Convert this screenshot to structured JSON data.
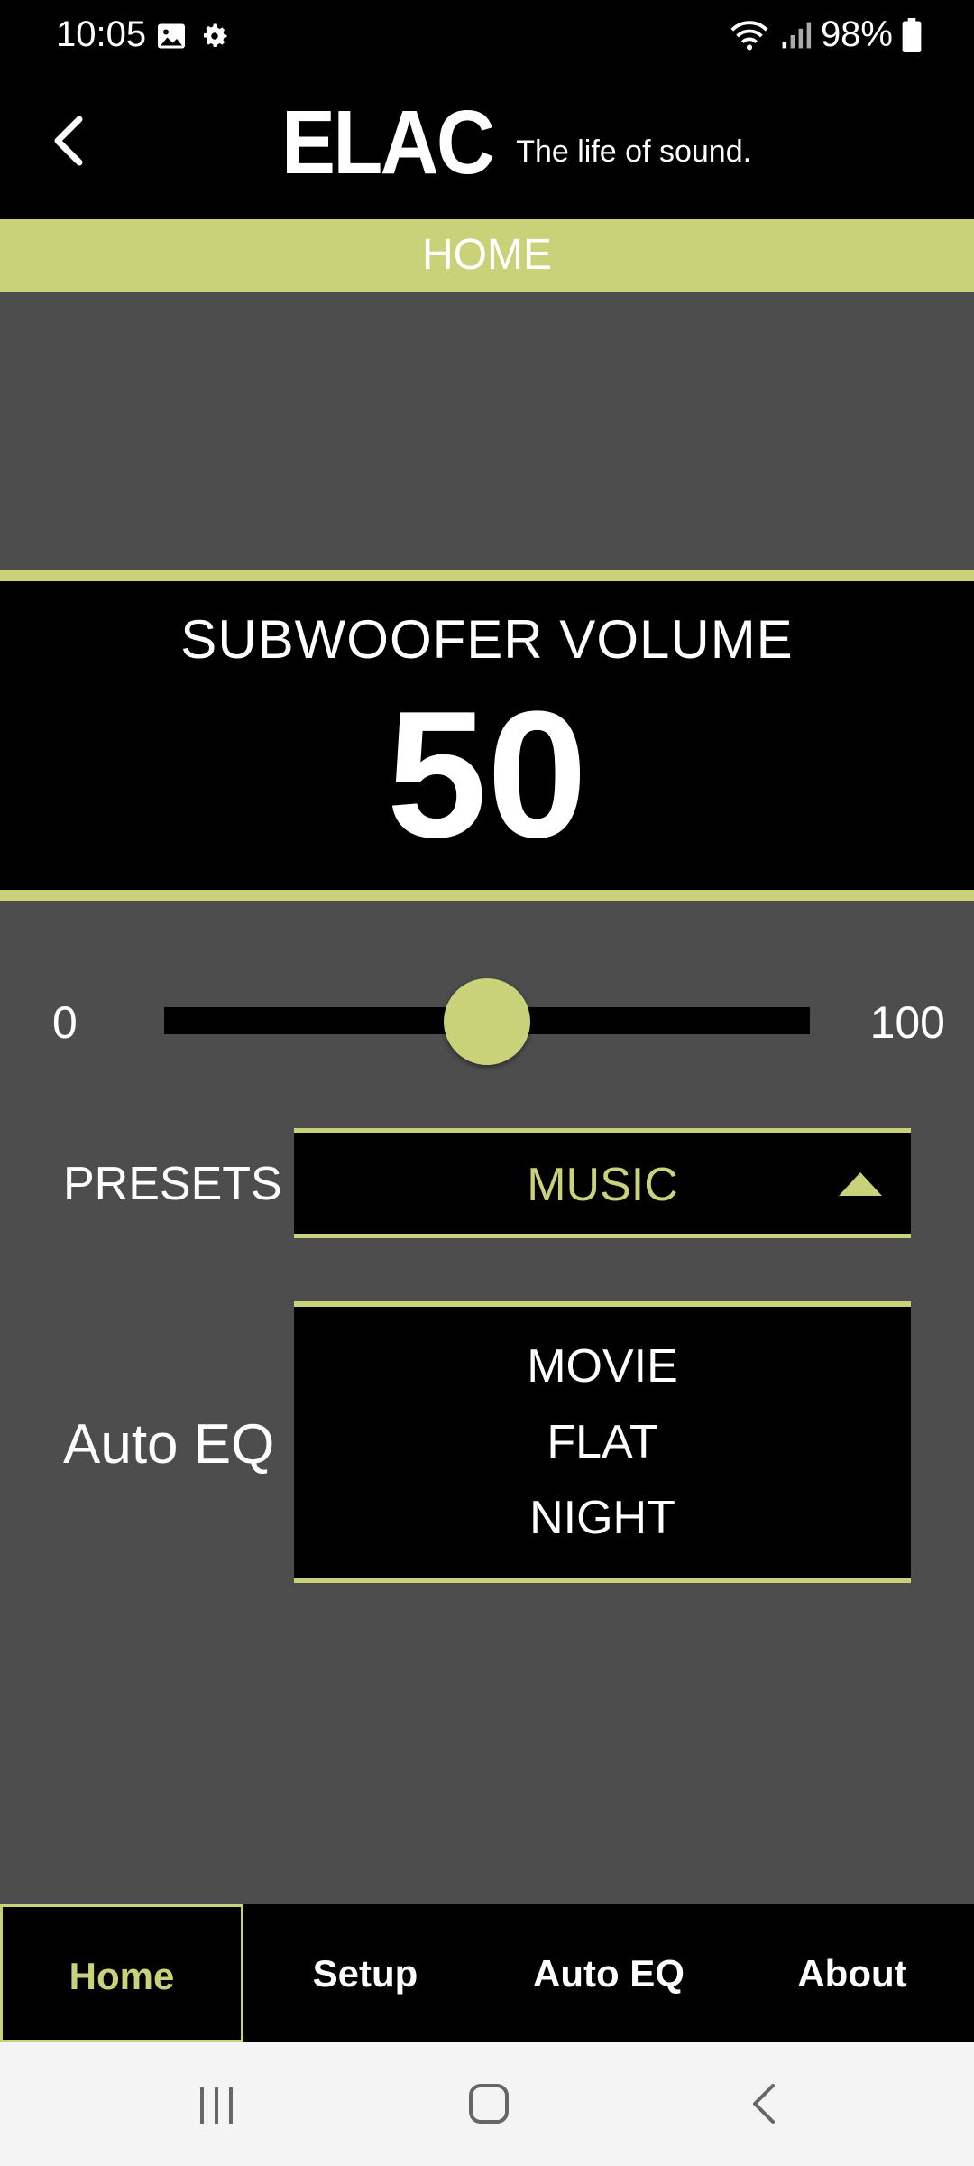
{
  "status_bar": {
    "time": "10:05",
    "battery": "98%",
    "icons": [
      "image-icon",
      "gear-icon",
      "wifi-icon",
      "signal-icon",
      "battery-icon"
    ]
  },
  "header": {
    "back_icon": "chevron-left-icon",
    "logo_text": "ELAC",
    "tagline": "The life of sound."
  },
  "title": "HOME",
  "volume": {
    "label": "SUBWOOFER VOLUME",
    "value": "50",
    "level": 50
  },
  "slider": {
    "min_label": "0",
    "max_label": "100"
  },
  "presets": {
    "label": "PRESETS",
    "selected": "MUSIC",
    "options": [
      "MOVIE",
      "FLAT",
      "NIGHT"
    ]
  },
  "autoeq": {
    "label": "Auto EQ"
  },
  "tabs": [
    {
      "label": "Home",
      "active": true
    },
    {
      "label": "Setup",
      "active": false
    },
    {
      "label": "Auto EQ",
      "active": false
    },
    {
      "label": "About",
      "active": false
    }
  ],
  "colors": {
    "accent": "#c9d279",
    "background": "#4d4d4d",
    "panel": "#000000"
  }
}
